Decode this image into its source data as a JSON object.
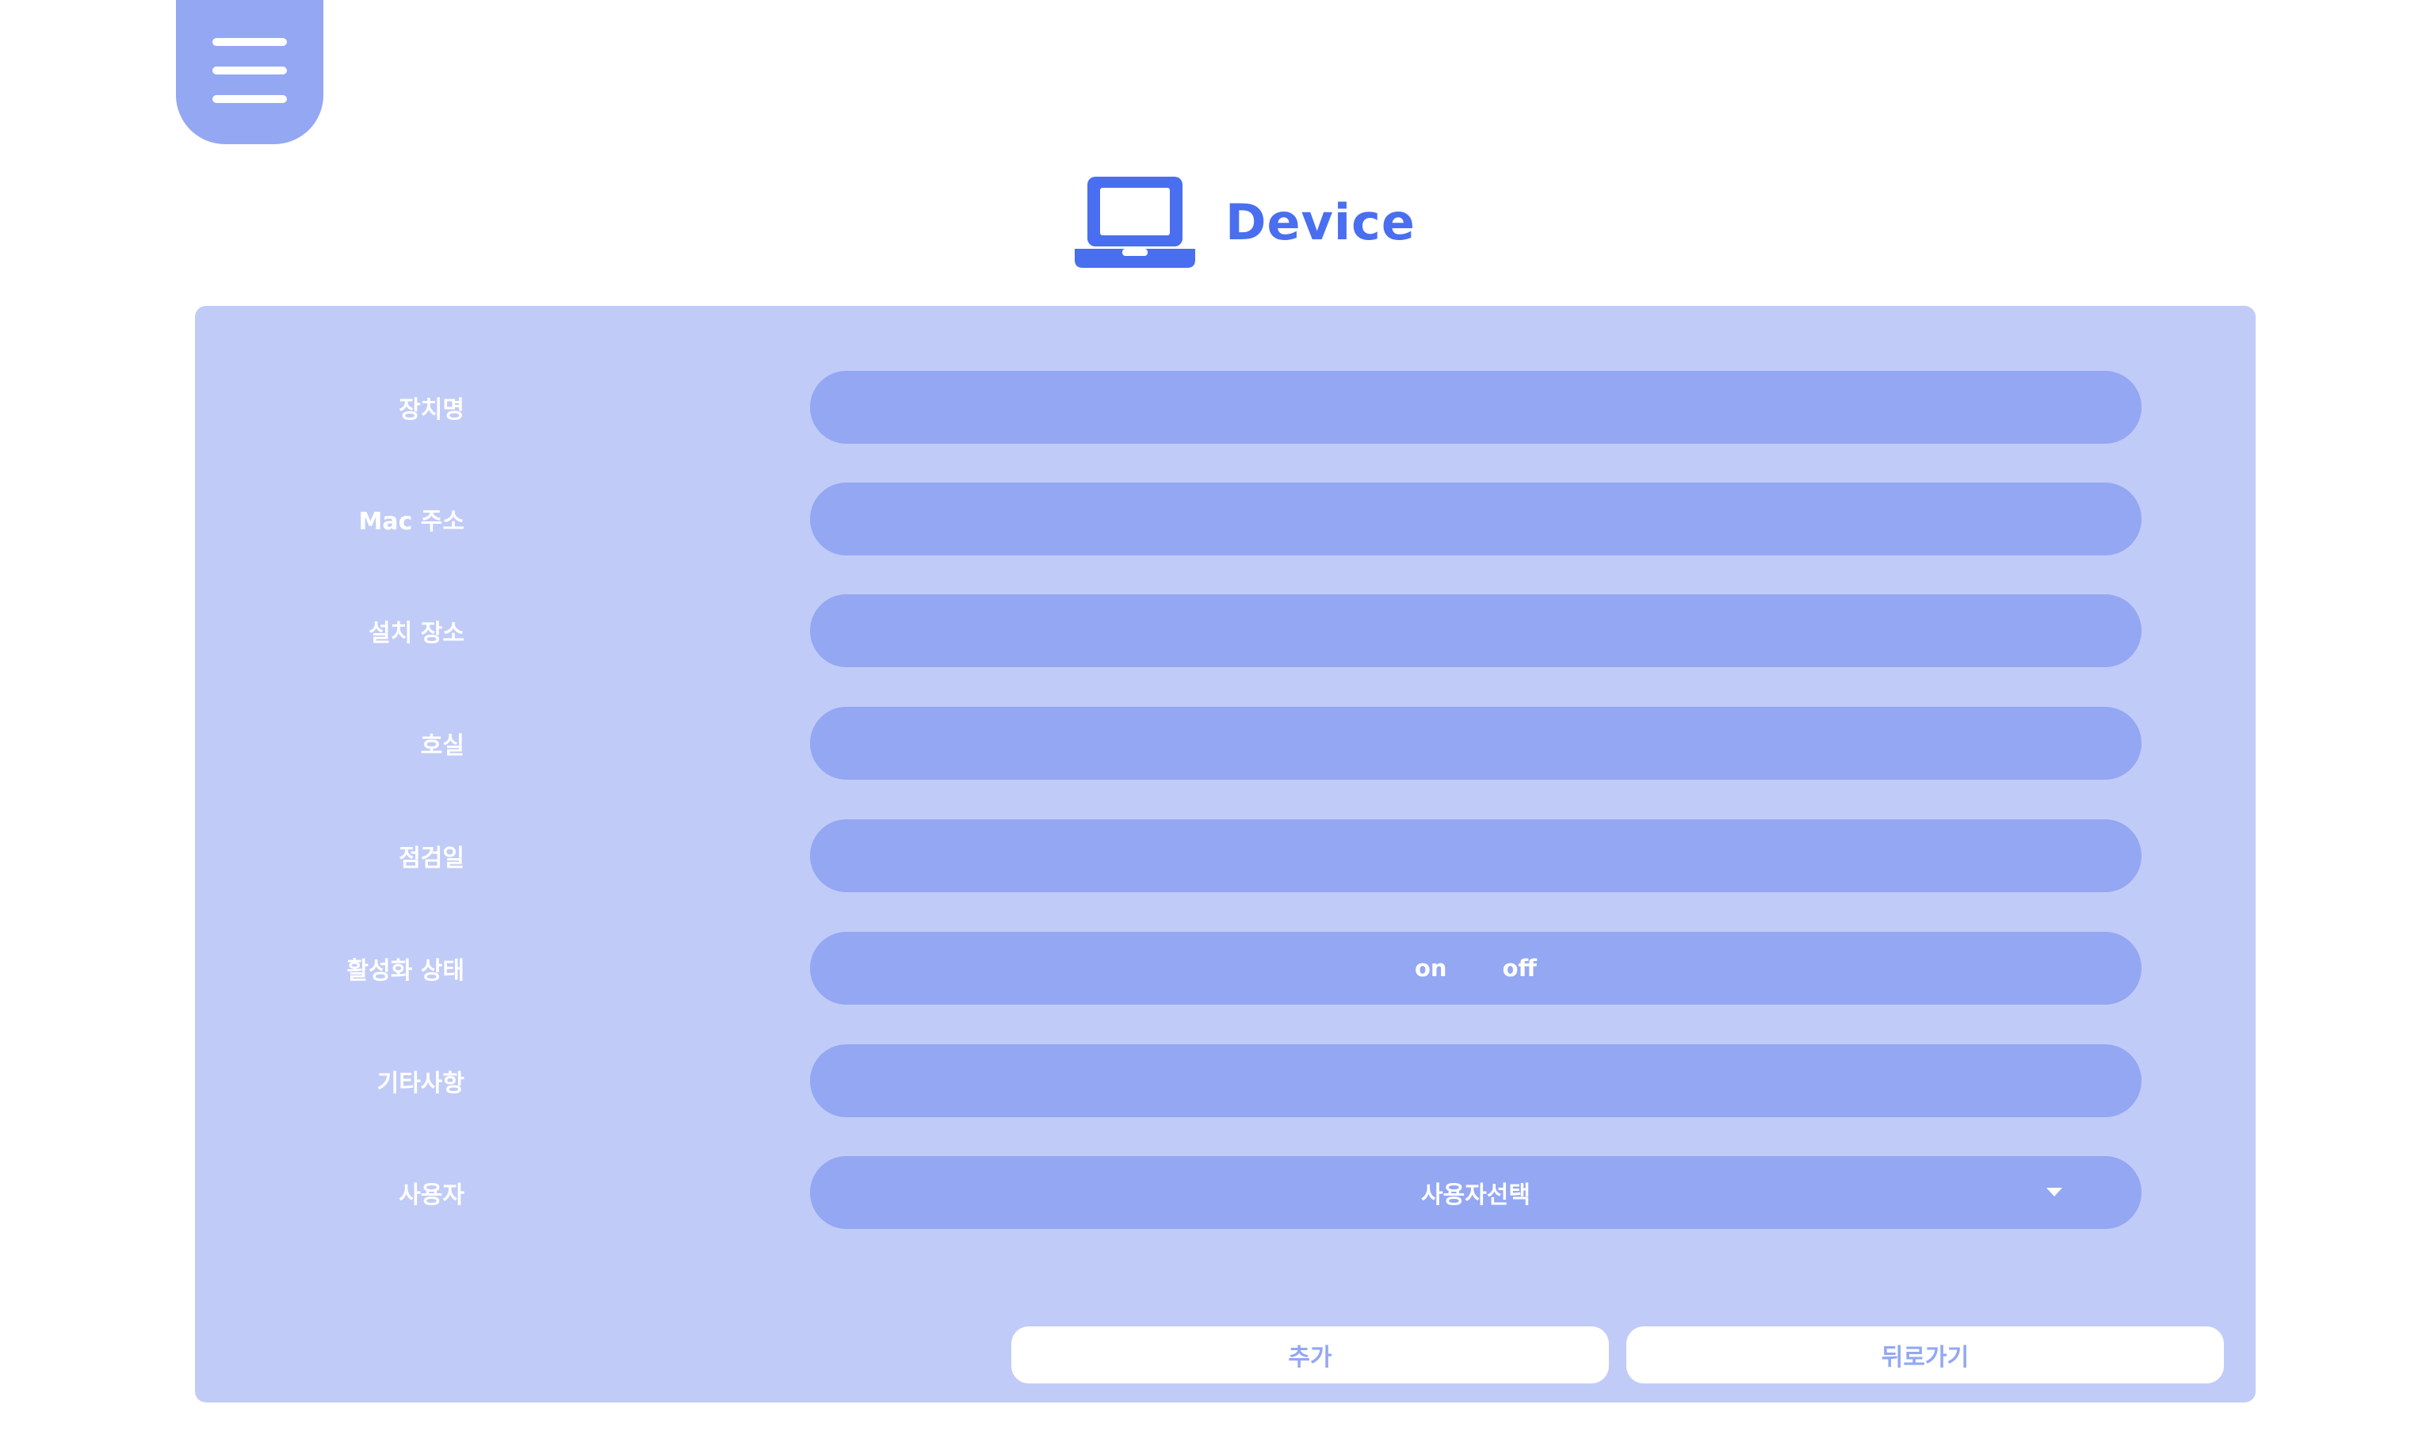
{
  "header": {
    "title": "Device",
    "icon": "laptop-icon",
    "menu_icon": "hamburger-menu-icon"
  },
  "colors": {
    "accent": "#4a6ef0",
    "panel": "#c1cbf7",
    "field": "#93a7f3",
    "button_bg": "#ffffff"
  },
  "form": {
    "device_name_label": "장치명",
    "device_name_value": "",
    "mac_label": "Mac 주소",
    "mac_value": "",
    "location_label": "설치 장소",
    "location_value": "",
    "room_label": "호실",
    "room_value": "",
    "inspection_label": "점검일",
    "inspection_value": "",
    "status_label": "활성화 상태",
    "status_on": "on",
    "status_off": "off",
    "notes_label": "기타사항",
    "notes_value": "",
    "user_label": "사용자",
    "user_select_value": "사용자선택"
  },
  "actions": {
    "add_label": "추가",
    "back_label": "뒤로가기"
  }
}
